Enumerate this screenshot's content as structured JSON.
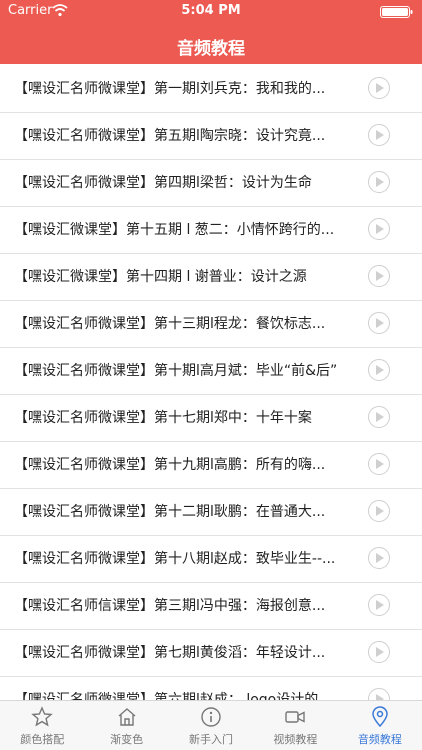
{
  "status": {
    "carrier": "Carrier",
    "time": "5:04 PM"
  },
  "header": {
    "title": "音频教程"
  },
  "list": {
    "items": [
      {
        "text": "【嘿设汇名师微课堂】第一期l刘兵克：我和我的..."
      },
      {
        "text": "【嘿设汇名师微课堂】第五期l陶宗晓：设计究竟..."
      },
      {
        "text": "【嘿设汇名师微课堂】第四期l梁哲：设计为生命"
      },
      {
        "text": "【嘿设汇微课堂】第十五期 l 葱二：小情怀跨行的..."
      },
      {
        "text": "【嘿设汇微课堂】第十四期 l 谢普业：设计之源"
      },
      {
        "text": "【嘿设汇名师微课堂】第十三期l程龙：餐饮标志..."
      },
      {
        "text": "【嘿设汇名师微课堂】第十期l高月斌：毕业“前&后”"
      },
      {
        "text": "【嘿设汇名师微课堂】第十七期l郑中：十年十案"
      },
      {
        "text": "【嘿设汇名师微课堂】第十九期l高鹏：所有的嗨..."
      },
      {
        "text": "【嘿设汇名师微课堂】第十二期l耿鹏：在普通大..."
      },
      {
        "text": "【嘿设汇名师微课堂】第十八期l赵成：致毕业生--..."
      },
      {
        "text": "【嘿设汇名师信课堂】第三期l冯中强：海报创意..."
      },
      {
        "text": "【嘿设汇名师微课堂】第七期l黄俊滔：年轻设计..."
      },
      {
        "text": "【嘿设汇名师微课堂】第六期l赵成： logo设计的..."
      }
    ]
  },
  "tabbar": {
    "tabs": [
      {
        "label": "颜色搭配",
        "icon": "star-icon"
      },
      {
        "label": "渐变色",
        "icon": "house-icon"
      },
      {
        "label": "新手入门",
        "icon": "info-icon"
      },
      {
        "label": "视频教程",
        "icon": "video-camera-icon"
      },
      {
        "label": "音频教程",
        "icon": "location-pin-icon"
      }
    ],
    "active_index": 4
  },
  "colors": {
    "header": "#ec5a52",
    "tab_active": "#3b7ad9",
    "tab_inactive": "#777777"
  }
}
